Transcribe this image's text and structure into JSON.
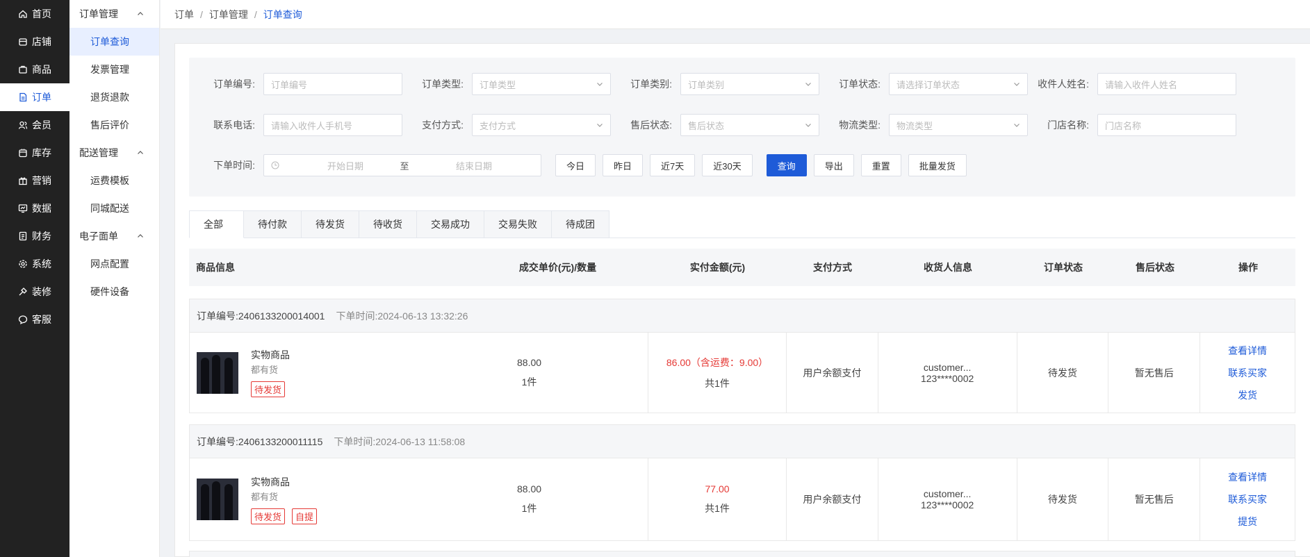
{
  "nav": {
    "items": [
      {
        "label": "首页",
        "icon": "home-icon"
      },
      {
        "label": "店铺",
        "icon": "shop-icon"
      },
      {
        "label": "商品",
        "icon": "goods-icon"
      },
      {
        "label": "订单",
        "icon": "order-icon"
      },
      {
        "label": "会员",
        "icon": "member-icon"
      },
      {
        "label": "库存",
        "icon": "stock-icon"
      },
      {
        "label": "营销",
        "icon": "gift-icon"
      },
      {
        "label": "数据",
        "icon": "data-icon"
      },
      {
        "label": "财务",
        "icon": "finance-icon"
      },
      {
        "label": "系统",
        "icon": "system-icon"
      },
      {
        "label": "装修",
        "icon": "decorate-icon"
      },
      {
        "label": "客服",
        "icon": "service-icon"
      }
    ],
    "active_index": 3
  },
  "subnav": {
    "groups": [
      {
        "label": "订单管理",
        "items": [
          "订单查询",
          "发票管理",
          "退货退款",
          "售后评价"
        ]
      },
      {
        "label": "配送管理",
        "items": [
          "运费模板",
          "同城配送"
        ]
      },
      {
        "label": "电子面单",
        "items": [
          "网点配置",
          "硬件设备"
        ]
      }
    ],
    "active": "订单查询"
  },
  "breadcrumb": {
    "items": [
      "订单",
      "订单管理",
      "订单查询"
    ],
    "separator": "/"
  },
  "filters": {
    "order_no": {
      "label": "订单编号:",
      "placeholder": "订单编号"
    },
    "order_type": {
      "label": "订单类型:",
      "placeholder": "订单类型"
    },
    "order_category": {
      "label": "订单类别:",
      "placeholder": "订单类别"
    },
    "order_status": {
      "label": "订单状态:",
      "placeholder": "请选择订单状态"
    },
    "receiver_name": {
      "label": "收件人姓名:",
      "placeholder": "请输入收件人姓名"
    },
    "phone": {
      "label": "联系电话:",
      "placeholder": "请输入收件人手机号"
    },
    "pay_method": {
      "label": "支付方式:",
      "placeholder": "支付方式"
    },
    "after_sale": {
      "label": "售后状态:",
      "placeholder": "售后状态"
    },
    "logistics": {
      "label": "物流类型:",
      "placeholder": "物流类型"
    },
    "store_name": {
      "label": "门店名称:",
      "placeholder": "门店名称"
    },
    "order_time": {
      "label": "下单时间:",
      "start_placeholder": "开始日期",
      "to": "至",
      "end_placeholder": "结束日期"
    },
    "quick": {
      "today": "今日",
      "yesterday": "昨日",
      "last7": "近7天",
      "last30": "近30天"
    },
    "actions": {
      "search": "查询",
      "export": "导出",
      "reset": "重置",
      "batch_ship": "批量发货"
    }
  },
  "tabs": [
    "全部",
    "待付款",
    "待发货",
    "待收货",
    "交易成功",
    "交易失败",
    "待成团"
  ],
  "active_tab": "全部",
  "table": {
    "headers": {
      "goods": "商品信息",
      "price": "成交单价(元)/数量",
      "paid": "实付金额(元)",
      "method": "支付方式",
      "receiver": "收货人信息",
      "status": "订单状态",
      "after": "售后状态",
      "op": "操作"
    }
  },
  "orders": [
    {
      "order_no": "订单编号:2406133200014001",
      "order_time": "下单时间:2024-06-13 13:32:26",
      "goods_name": "实物商品",
      "goods_sub": "都有货",
      "tags": [
        "待发货"
      ],
      "price": "88.00",
      "qty": "1件",
      "paid": "86.00（含运费：9.00）",
      "count": "共1件",
      "method": "用户余额支付",
      "receiver_name": "customer...",
      "receiver_phone": "123****0002",
      "status": "待发货",
      "after": "暂无售后",
      "ops": [
        "查看详情",
        "联系买家",
        "发货"
      ]
    },
    {
      "order_no": "订单编号:2406133200011115",
      "order_time": "下单时间:2024-06-13 11:58:08",
      "goods_name": "实物商品",
      "goods_sub": "都有货",
      "tags": [
        "待发货",
        "自提"
      ],
      "price": "88.00",
      "qty": "1件",
      "paid": "77.00",
      "count": "共1件",
      "method": "用户余额支付",
      "receiver_name": "customer...",
      "receiver_phone": "123****0002",
      "status": "待发货",
      "after": "暂无售后",
      "ops": [
        "查看详情",
        "联系买家",
        "提货"
      ]
    }
  ],
  "colors": {
    "accent": "#1e5bd8",
    "sidebar": "#222222",
    "danger": "#e53935"
  }
}
